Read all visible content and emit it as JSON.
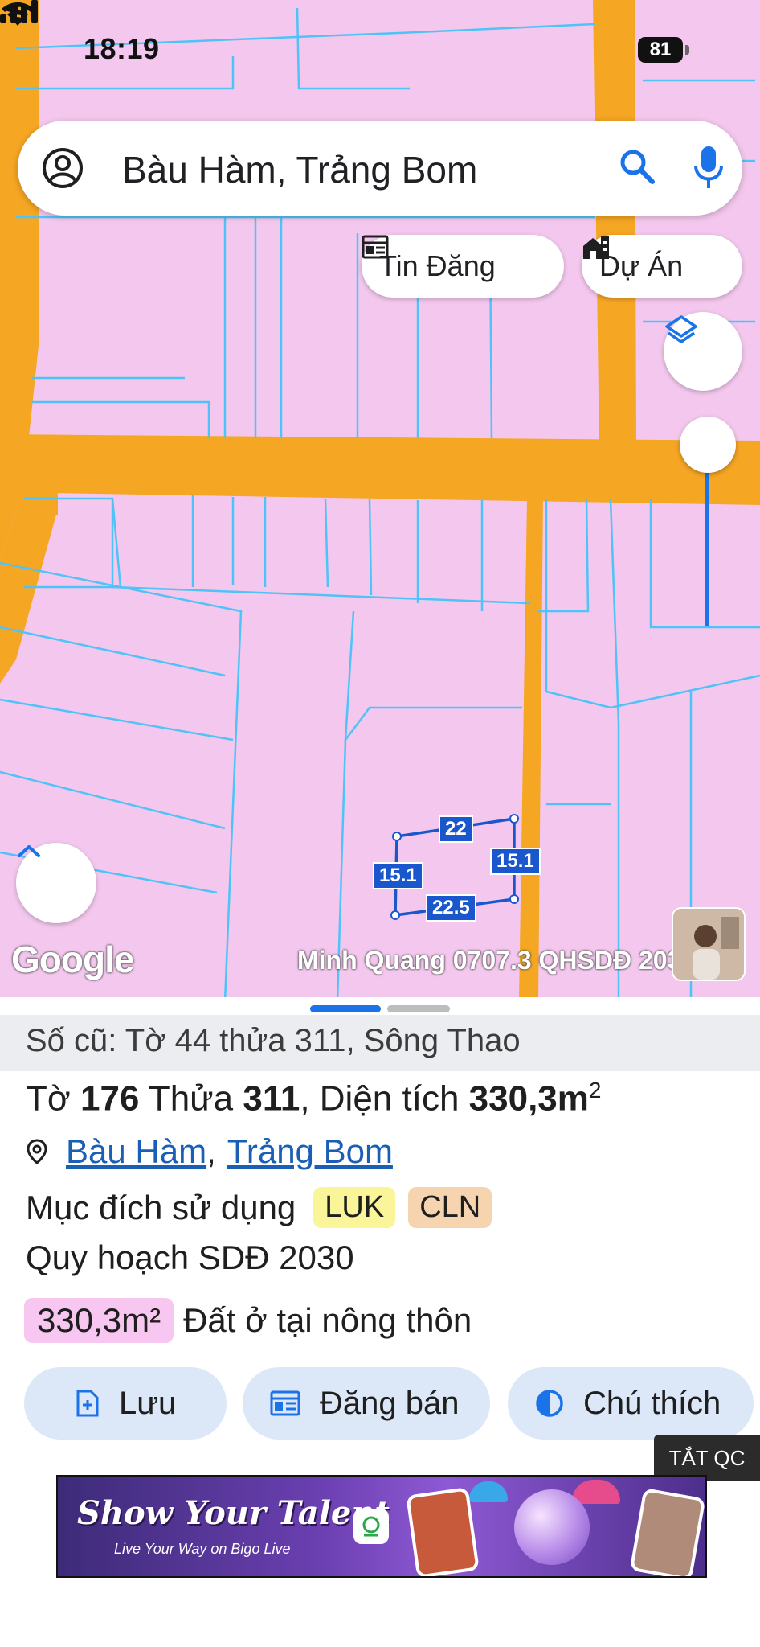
{
  "status_bar": {
    "time": "18:19",
    "battery": "81"
  },
  "search": {
    "query": "Bàu Hàm, Trảng Bom"
  },
  "chips": {
    "news": "Tin Đăng",
    "projects": "Dự Án"
  },
  "map": {
    "google_logo": "Google",
    "watermark": "Minh Quang 0707.3 QHSDĐ 2030",
    "edges": {
      "top": "22",
      "left": "15.1",
      "right": "15.1",
      "bottom": "22.5"
    }
  },
  "sheet": {
    "old_ref": "Số cũ: Tờ 44 thửa 311, Sông Thao",
    "parcel": {
      "sheet_label": "Tờ",
      "sheet_no": "176",
      "plot_label": "Thửa",
      "plot_no": "311",
      "area_label": ", Diện tích",
      "area_value": "330,3m",
      "area_unit": "2"
    },
    "address": {
      "commune": "Bàu Hàm",
      "separator": ",",
      "district": "Trảng Bom"
    },
    "purpose": {
      "label": "Mục đích sử dụng",
      "codes": [
        "LUK",
        "CLN"
      ]
    },
    "plan_title": "Quy hoạch SDĐ 2030",
    "land_use": {
      "area": "330,3m²",
      "type": "Đất ở tại nông thôn"
    },
    "actions": {
      "save": "Lưu",
      "post": "Đăng bán",
      "legend": "Chú thích"
    },
    "ads_off": "TẮT QC",
    "ad": {
      "title": "Show Your Talent",
      "subtitle": "Live Your Way on Bigo Live"
    }
  },
  "colors": {
    "parcel": "#f4c8ee",
    "road": "#f5a623",
    "boundary": "#4fc3f7",
    "accent": "#1a73e8"
  }
}
